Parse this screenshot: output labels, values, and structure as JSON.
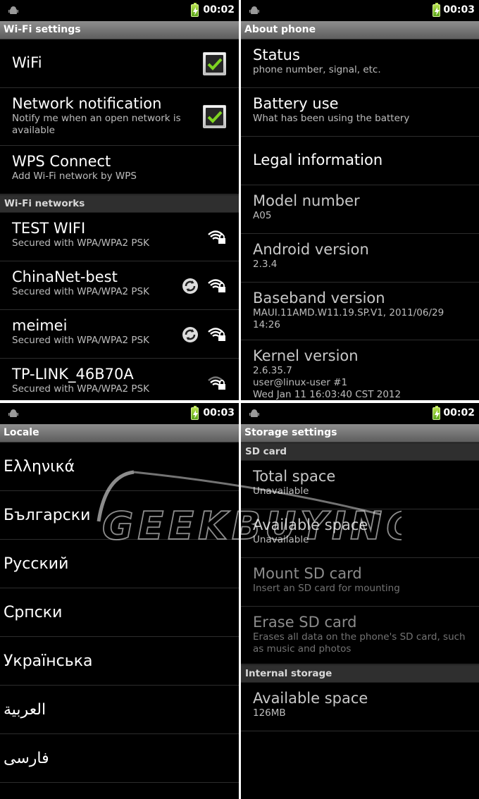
{
  "panels": {
    "wifi": {
      "status_time": "00:02",
      "title": "Wi-Fi settings",
      "items": [
        {
          "title": "WiFi",
          "summary": ""
        },
        {
          "title": "Network notification",
          "summary": "Notify me when an open network is available"
        },
        {
          "title": "WPS Connect",
          "summary": "Add Wi-Fi network by WPS"
        }
      ],
      "section": "Wi-Fi networks",
      "networks": [
        {
          "ssid": "TEST WIFI",
          "security": "Secured with WPA/WPA2 PSK"
        },
        {
          "ssid": "ChinaNet-best",
          "security": "Secured with WPA/WPA2 PSK"
        },
        {
          "ssid": "meimei",
          "security": "Secured with WPA/WPA2 PSK"
        },
        {
          "ssid": "TP-LINK_46B70A",
          "security": "Secured with WPA/WPA2 PSK"
        }
      ]
    },
    "about": {
      "status_time": "00:03",
      "title": "About phone",
      "items": [
        {
          "title": "Status",
          "summary": "phone number, signal, etc."
        },
        {
          "title": "Battery use",
          "summary": "What has been using the battery"
        },
        {
          "title": "Legal information",
          "summary": ""
        },
        {
          "title": "Model number",
          "summary": "A05"
        },
        {
          "title": "Android version",
          "summary": "2.3.4"
        },
        {
          "title": "Baseband version",
          "summary": "MAUI.11AMD.W11.19.SP.V1, 2011/06/29 14:26"
        },
        {
          "title": "Kernel version",
          "summary": "2.6.35.7\nuser@linux-user #1\nWed Jan 11 16:03:40 CST 2012"
        }
      ]
    },
    "locale": {
      "status_time": "00:03",
      "title": "Locale",
      "languages": [
        "Ελληνικά",
        "Български",
        "Русский",
        "Српски",
        "Українська",
        "العربية",
        "فارسی"
      ]
    },
    "storage": {
      "status_time": "00:02",
      "title": "Storage settings",
      "section_sd": "SD card",
      "sd_items": [
        {
          "title": "Total space",
          "summary": "Unavailable"
        },
        {
          "title": "Available space",
          "summary": "Unavailable"
        },
        {
          "title": "Mount SD card",
          "summary": "Insert an SD card for mounting"
        },
        {
          "title": "Erase SD card",
          "summary": "Erases all data on the phone's SD card, such as music and photos"
        }
      ],
      "section_internal": "Internal storage",
      "internal_items": [
        {
          "title": "Available space",
          "summary": "126MB"
        }
      ]
    }
  },
  "watermark": {
    "text": "GEEKBUYING"
  },
  "colors": {
    "battery": "#8fd13a",
    "check": "#7ed321",
    "titlebar": "#7a7a7a"
  }
}
